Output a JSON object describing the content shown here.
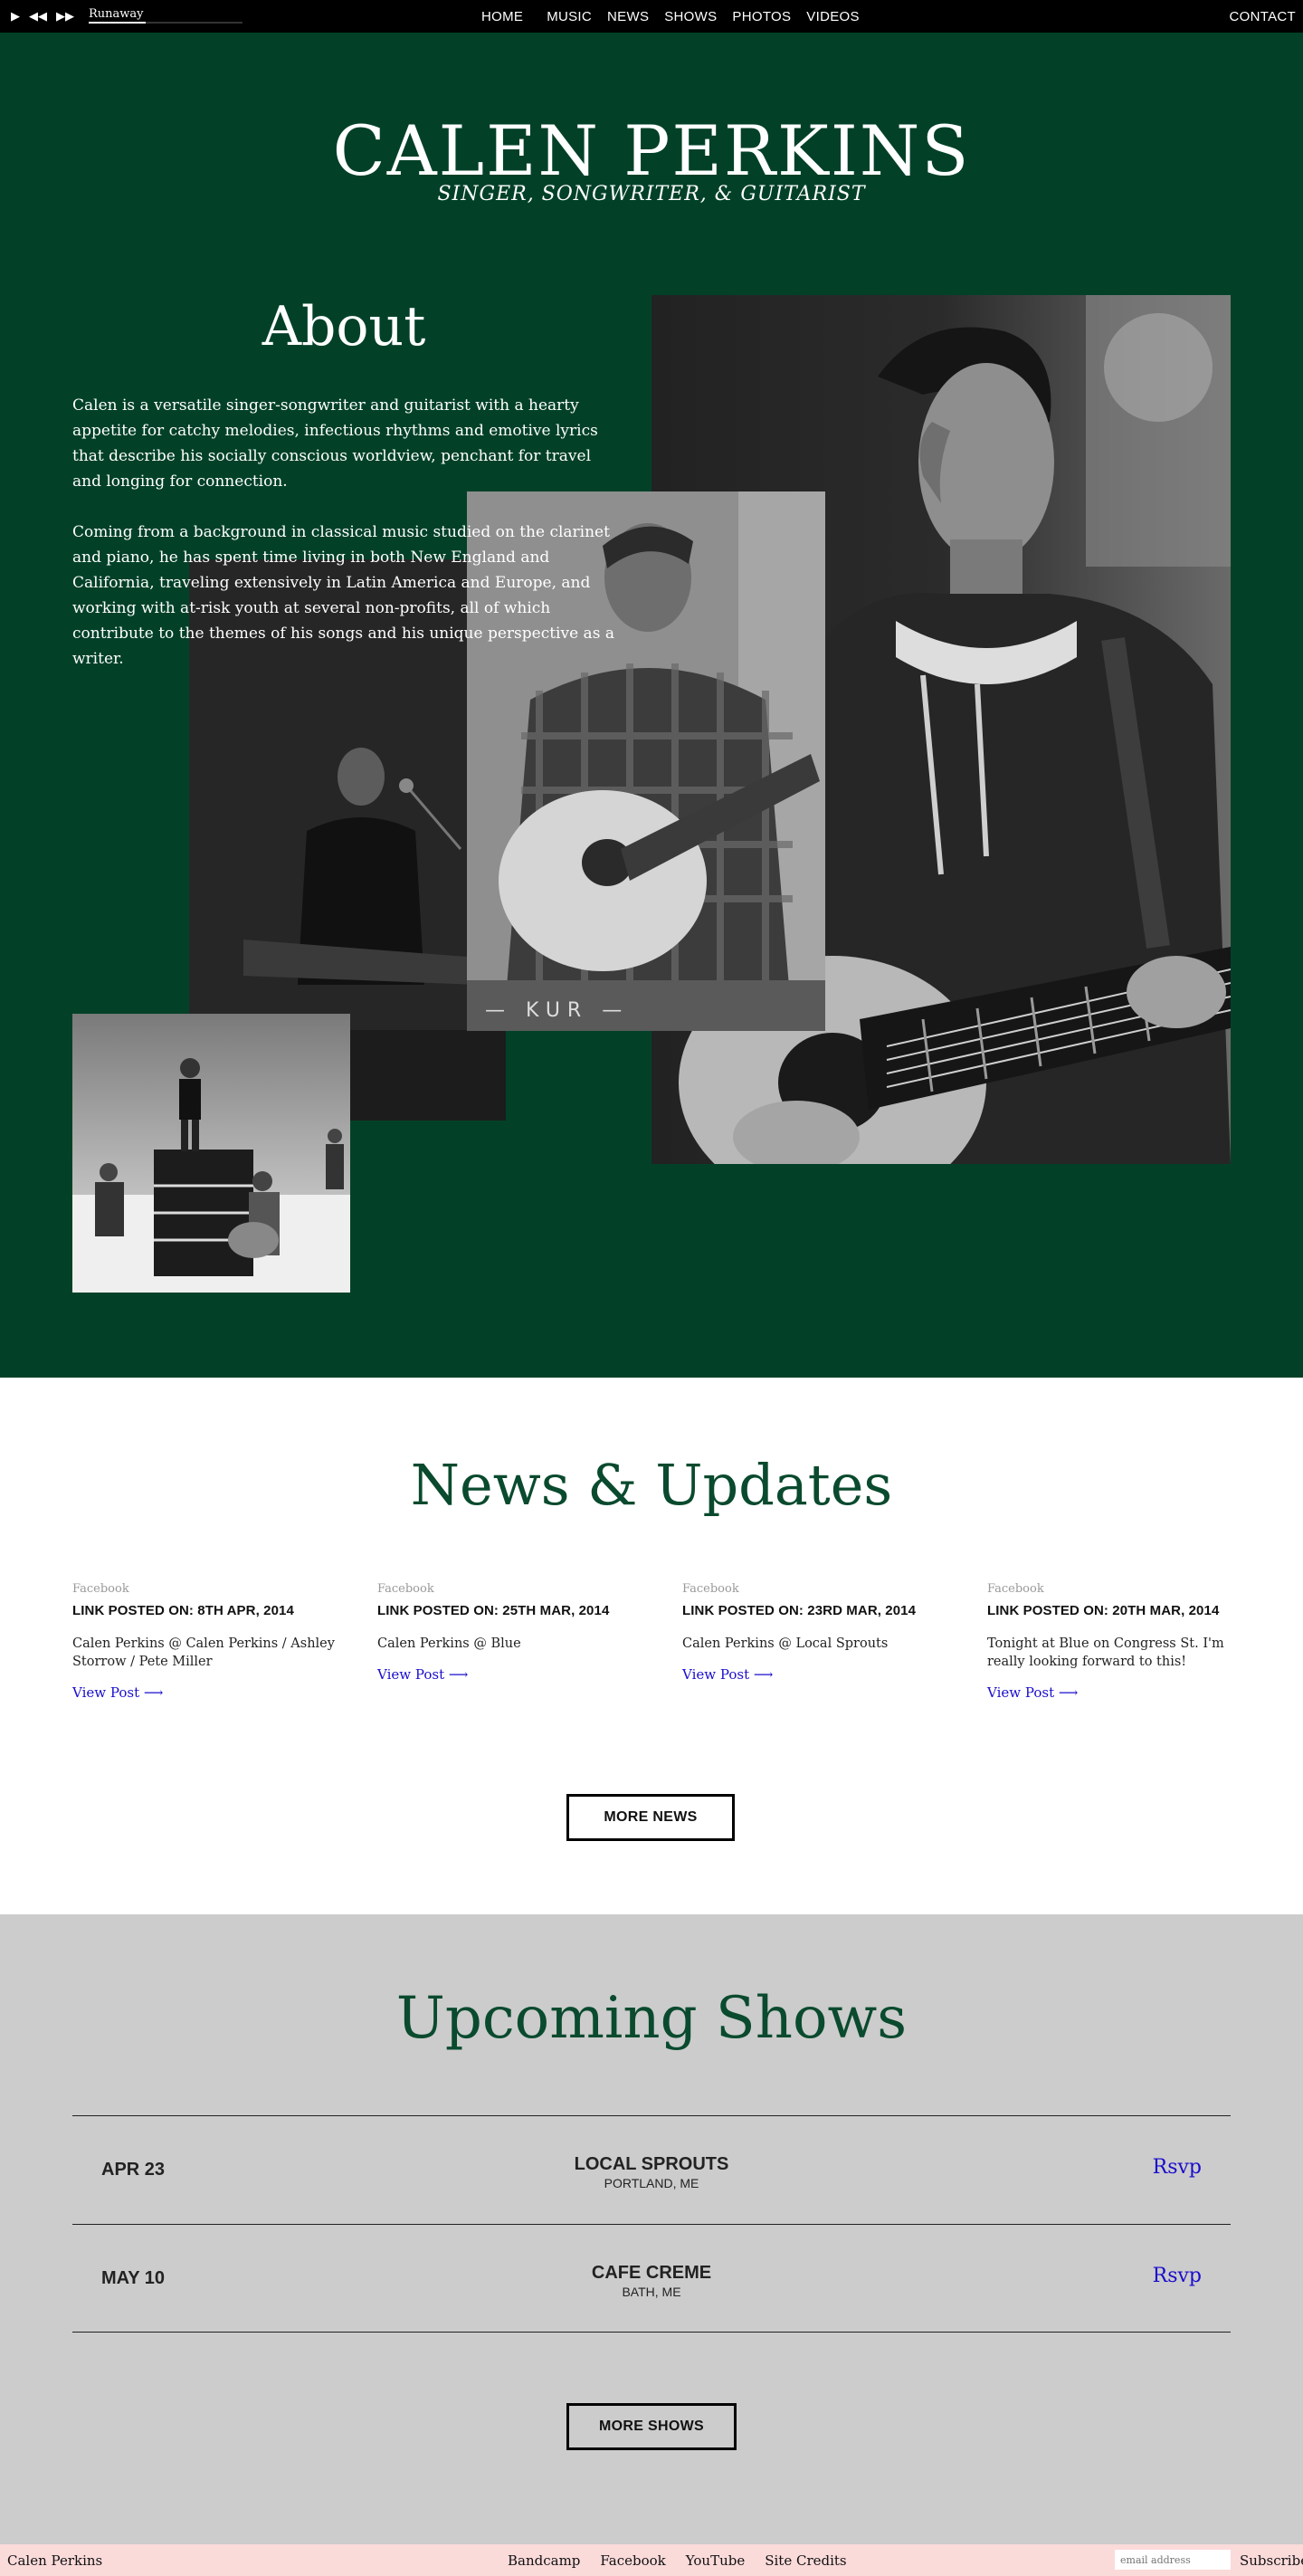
{
  "player": {
    "track": "Runaway",
    "progress": 0.37,
    "controls": [
      "play-icon",
      "previous-icon",
      "next-icon"
    ]
  },
  "nav": {
    "items": [
      "HOME",
      "MUSIC",
      "NEWS",
      "SHOWS",
      "PHOTOS",
      "VIDEOS"
    ],
    "contact": "CONTACT"
  },
  "hero": {
    "title": "CALEN PERKINS",
    "subtitle": "SINGER,  SONGWRITER,  &  GUITARIST",
    "background": "#024128"
  },
  "about": {
    "title": "About",
    "paragraphs": [
      "Calen is a versatile singer-songwriter and guitarist with a hearty appetite for catchy melodies, infectious rhythms and emotive lyrics that describe his socially conscious worldview, penchant for travel and longing for connection.",
      "Coming from a background in classical music studied on the clarinet and piano, he has spent time living in both New England and California, traveling extensively in Latin America and Europe, and working with at-risk youth at several non-profits, all of which contribute to the themes of his songs and his unique perspective as a writer."
    ]
  },
  "news": {
    "title": "News & Updates",
    "items": [
      {
        "source": "Facebook",
        "date": "LINK POSTED ON: 8TH APR, 2014",
        "body": "Calen Perkins @ Calen Perkins / Ashley Storrow / Pete Miller",
        "link": "View Post ⟶"
      },
      {
        "source": "Facebook",
        "date": "LINK POSTED ON: 25TH MAR, 2014",
        "body": "Calen Perkins @ Blue",
        "link": "View Post ⟶"
      },
      {
        "source": "Facebook",
        "date": "LINK POSTED ON: 23RD MAR, 2014",
        "body": "Calen Perkins @ Local Sprouts",
        "link": "View Post ⟶"
      },
      {
        "source": "Facebook",
        "date": "LINK POSTED ON: 20TH MAR, 2014",
        "body": "Tonight at Blue on Congress St. I'm really looking forward to this!",
        "link": "View Post ⟶"
      }
    ],
    "more": "MORE NEWS"
  },
  "shows": {
    "title": "Upcoming Shows",
    "items": [
      {
        "date": "APR 23",
        "venue": "LOCAL SPROUTS",
        "location": "PORTLAND, ME",
        "rsvp": "Rsvp"
      },
      {
        "date": "MAY 10",
        "venue": "CAFE CREME",
        "location": "BATH, ME",
        "rsvp": "Rsvp"
      }
    ],
    "more": "MORE SHOWS"
  },
  "footer": {
    "name": "Calen Perkins",
    "links": [
      "Bandcamp",
      "Facebook",
      "YouTube",
      "Site Credits"
    ],
    "email_placeholder": "email address",
    "subscribe": "Subscribe"
  }
}
